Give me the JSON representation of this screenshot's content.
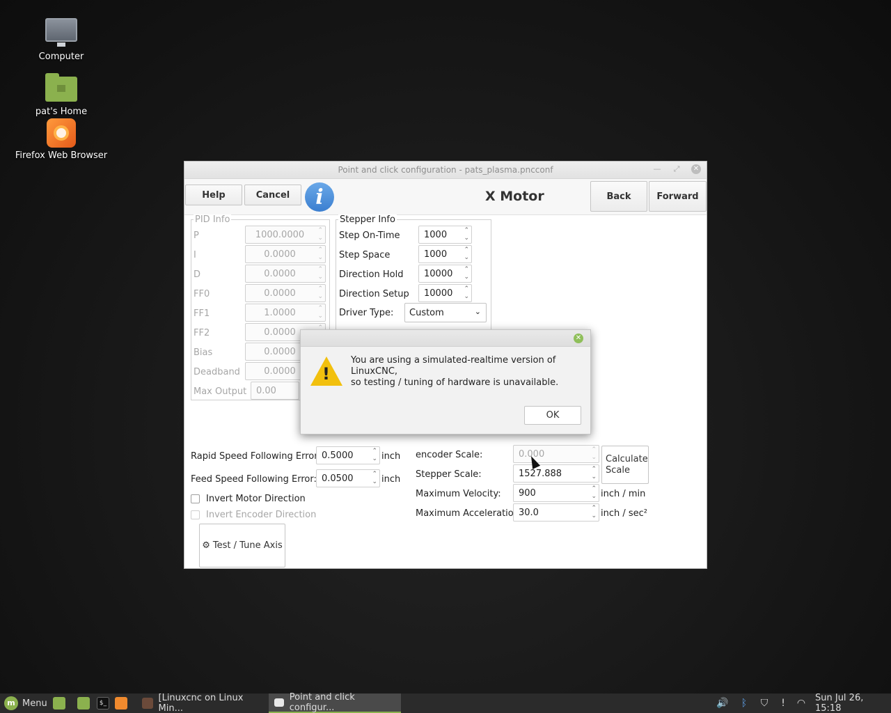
{
  "desktop": {
    "icons": [
      {
        "label": "Computer"
      },
      {
        "label": "pat's Home"
      },
      {
        "label": "Firefox Web Browser"
      }
    ]
  },
  "window": {
    "title": "Point and click configuration - pats_plasma.pncconf",
    "toolbar": {
      "help": "Help",
      "cancel": "Cancel",
      "info_icon": "i",
      "page_title": "X Motor",
      "back": "Back",
      "forward": "Forward"
    },
    "pid": {
      "title": "PID Info",
      "rows": [
        {
          "label": "P",
          "value": "1000.0000"
        },
        {
          "label": "I",
          "value": "0.0000"
        },
        {
          "label": "D",
          "value": "0.0000"
        },
        {
          "label": "FF0",
          "value": "0.0000"
        },
        {
          "label": "FF1",
          "value": "1.0000"
        },
        {
          "label": "FF2",
          "value": "0.0000"
        },
        {
          "label": "Bias",
          "value": "0.0000"
        },
        {
          "label": "Deadband",
          "value": "0.0000"
        },
        {
          "label": "Max Output",
          "value": "0.00"
        }
      ]
    },
    "stepper": {
      "title": "Stepper Info",
      "rows": [
        {
          "label": "Step On-Time",
          "value": "1000"
        },
        {
          "label": "Step Space",
          "value": "1000"
        },
        {
          "label": "Direction Hold",
          "value": "10000"
        },
        {
          "label": "Direction Setup",
          "value": "10000"
        }
      ],
      "driver_label": "Driver Type:",
      "driver_value": "Custom"
    },
    "following": {
      "rapid_label": "Rapid Speed Following Error:",
      "rapid_value": "0.5000",
      "rapid_unit": "inch",
      "feed_label": "Feed Speed Following Error:",
      "feed_value": "0.0500",
      "feed_unit": "inch"
    },
    "checks": {
      "invert_motor": "Invert Motor Direction",
      "invert_encoder": "Invert Encoder Direction"
    },
    "test_button": "Test / Tune Axis",
    "scale": {
      "encoder_label": "encoder Scale:",
      "encoder_value": "0.000",
      "stepper_label": "Stepper Scale:",
      "stepper_value": "1527.888",
      "calc_button_line1": "Calculate",
      "calc_button_line2": "Scale",
      "maxvel_label": "Maximum Velocity:",
      "maxvel_value": "900",
      "maxvel_unit": "inch / min",
      "maxacc_label": "Maximum Acceleration:",
      "maxacc_value": "30.0",
      "maxacc_unit": "inch / sec²"
    }
  },
  "dialog": {
    "message_line1": "You are using a simulated-realtime version of LinuxCNC,",
    "message_line2": "so testing / tuning of hardware is unavailable.",
    "ok": "OK",
    "icon": "warning-icon"
  },
  "taskbar": {
    "menu": "Menu",
    "win1": "[Linuxcnc on Linux Min...",
    "win2": "Point and click configur...",
    "clock": "Sun Jul 26, 15:18"
  }
}
